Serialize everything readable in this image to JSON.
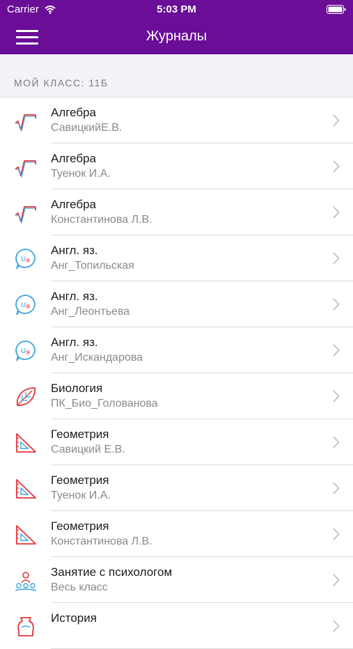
{
  "status": {
    "carrier": "Carrier",
    "time": "5:03 PM"
  },
  "header": {
    "title": "Журналы"
  },
  "section": {
    "title": "МОЙ КЛАСС: 11Б"
  },
  "items": [
    {
      "title": "Алгебра",
      "subtitle": "СавицкийЕ.В.",
      "icon": "algebra-icon"
    },
    {
      "title": "Алгебра",
      "subtitle": "Туенок И.А.",
      "icon": "algebra-icon"
    },
    {
      "title": "Алгебра",
      "subtitle": "Константинова Л.В.",
      "icon": "algebra-icon"
    },
    {
      "title": "Англ. яз.",
      "subtitle": "Анг_Топильская",
      "icon": "english-icon"
    },
    {
      "title": "Англ. яз.",
      "subtitle": "Анг_Леонтьева",
      "icon": "english-icon"
    },
    {
      "title": "Англ. яз.",
      "subtitle": "Анг_Искандарова",
      "icon": "english-icon"
    },
    {
      "title": "Биология",
      "subtitle": "ПК_Био_Голованова",
      "icon": "leaf-icon"
    },
    {
      "title": "Геометрия",
      "subtitle": "Савицкий Е.В.",
      "icon": "geometry-icon"
    },
    {
      "title": "Геометрия",
      "subtitle": "Туенок И.А.",
      "icon": "geometry-icon"
    },
    {
      "title": "Геометрия",
      "subtitle": "Константинова Л.В.",
      "icon": "geometry-icon"
    },
    {
      "title": "Занятие с психологом",
      "subtitle": "Весь класс",
      "icon": "people-icon"
    },
    {
      "title": "История",
      "subtitle": "",
      "icon": "history-icon"
    }
  ],
  "colors": {
    "accent": "#6a0d97",
    "icon_red": "#e3353b",
    "icon_blue": "#3aa3e3"
  }
}
